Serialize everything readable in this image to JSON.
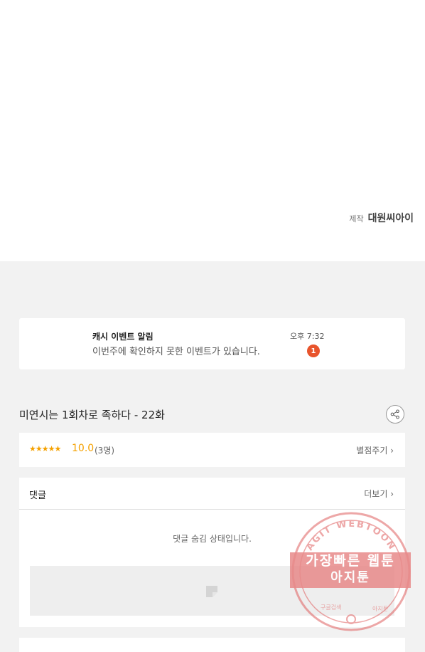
{
  "credit": {
    "label": "제작",
    "studio": "대원씨아이"
  },
  "notice": {
    "title": "캐시 이벤트 알림",
    "message": "이번주에 확인하지 못한 이벤트가 있습니다.",
    "time": "오후 7:32",
    "badge_count": "1"
  },
  "episode": {
    "title": "미연시는 1회차로 족하다 - 22화"
  },
  "rating": {
    "stars": "★★★★★",
    "score": "10.0",
    "count": "(3명)",
    "rate_button": "별점주기 ›"
  },
  "comments": {
    "label": "댓글",
    "more_button": "더보기 ›",
    "hidden_message": "댓글 숨김 상태입니다."
  },
  "watermark": {
    "arc_text": "AGIT WEBTOON",
    "band_line1": "가장빠른 웹툰",
    "band_line2": "아지툰",
    "bottom_left": "구글검색",
    "bottom_right": "아지툰",
    "color": "#e06060"
  }
}
